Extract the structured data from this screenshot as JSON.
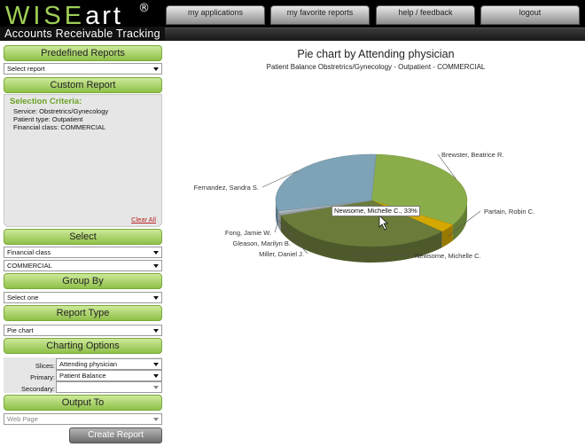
{
  "header": {
    "logo_main": "WISE",
    "logo_accent": "art",
    "logo_mark": "®",
    "tagline": "Accounts Receivable Tracking",
    "nav": [
      "my applications",
      "my favorite reports",
      "help / feedback",
      "logout"
    ]
  },
  "sidebar": {
    "predefined_title": "Predefined Reports",
    "predefined_select": "Select report",
    "custom_title": "Custom Report",
    "criteria_title": "Selection Criteria:",
    "criteria": [
      "Service: Obstretrics/Gynecology",
      "Patient type: Outpatient",
      "Financial class: COMMERCIAL"
    ],
    "clear_all": "Clear All",
    "select_title": "Select",
    "select_field": "Financial class",
    "select_value": "COMMERCIAL",
    "group_title": "Group By",
    "group_select": "Select one",
    "type_title": "Report Type",
    "type_select": "Pie chart",
    "charting_title": "Charting Options",
    "slices_label": "Slices:",
    "slices_value": "Attending physician",
    "primary_label": "Primary:",
    "primary_value": "Patient Balance",
    "secondary_label": "Secondary:",
    "secondary_value": "",
    "output_title": "Output To",
    "output_select": "Web Page",
    "create_button": "Create Report"
  },
  "main": {
    "tooltip": "Newsome, Michelle C., 33%"
  },
  "chart_data": {
    "type": "pie",
    "title": "Pie chart by Attending physician",
    "subtitle": "Patient Balance Obstretrics/Gynecology - Outpatient - COMMERCIAL",
    "slices": [
      {
        "name": "Brewster, Beatrice R.",
        "value": 33,
        "color": "#8aad4a"
      },
      {
        "name": "Partain, Robin C.",
        "value": 3,
        "color": "#d4a800"
      },
      {
        "name": "Newsome, Michelle C.",
        "value": 33,
        "color": "#6b7c3a"
      },
      {
        "name": "Miller, Daniel J.",
        "value": 0.5,
        "color": "#9aa2a8"
      },
      {
        "name": "Gleason, Marilyn B.",
        "value": 0.5,
        "color": "#a9b3ba"
      },
      {
        "name": "Fong, Jamie W.",
        "value": 0.5,
        "color": "#b8c2c9"
      },
      {
        "name": "Fernandez, Sandra S.",
        "value": 29.5,
        "color": "#7fa3b6"
      }
    ]
  }
}
